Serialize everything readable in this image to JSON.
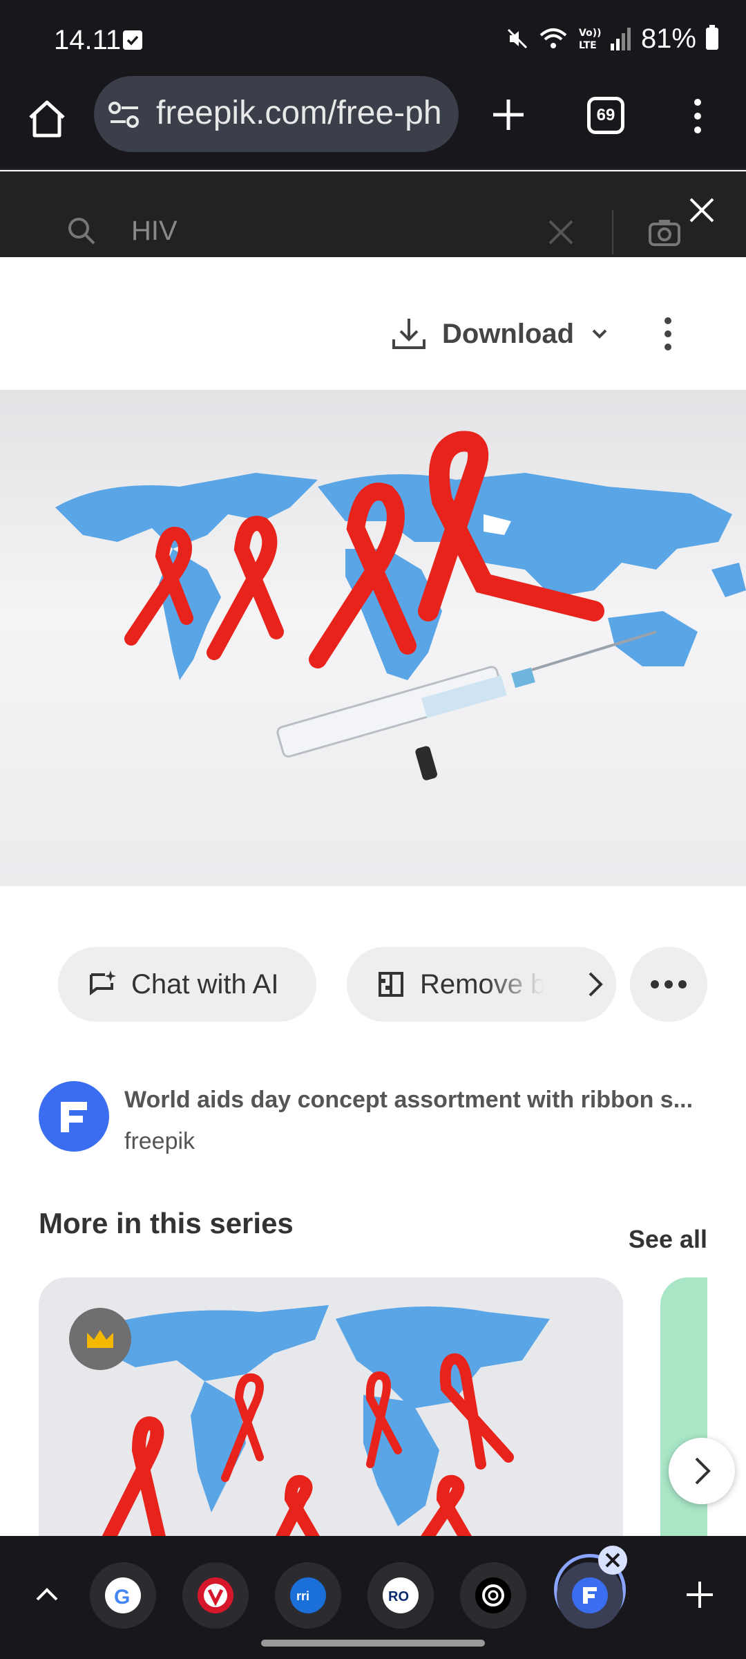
{
  "status_bar": {
    "time": "14.11",
    "battery": "81%",
    "icons": [
      "check-icon",
      "mute-icon",
      "wifi-icon",
      "volte-icon",
      "signal-icon",
      "battery-icon"
    ]
  },
  "browser": {
    "url": "freepik.com/free-ph",
    "tab_count": "69",
    "icons": [
      "home-icon",
      "tune-icon",
      "plus-icon",
      "tabs-icon",
      "more-vert-icon"
    ]
  },
  "search": {
    "value": "HIV",
    "icons": [
      "search-icon",
      "clear-icon",
      "camera-icon",
      "close-icon"
    ]
  },
  "download": {
    "label": "Download"
  },
  "actions": {
    "chat_label": "Chat with AI",
    "remove_label": "Remove ba"
  },
  "author": {
    "title": "World aids day concept assortment with ribbon s...",
    "name": "freepik"
  },
  "series": {
    "title": "More in this series",
    "see_all": "See all"
  },
  "bottom_tabs": [
    "Google",
    "Vivaldi",
    "rri",
    "RO",
    "ChatGPT",
    "Freepik"
  ],
  "colors": {
    "chrome_dark": "#17171c",
    "accent_blue": "#3a6df0",
    "ribbon_red": "#e8231c",
    "map_blue": "#5aa5e6",
    "active_ring": "#8aa4ff"
  }
}
